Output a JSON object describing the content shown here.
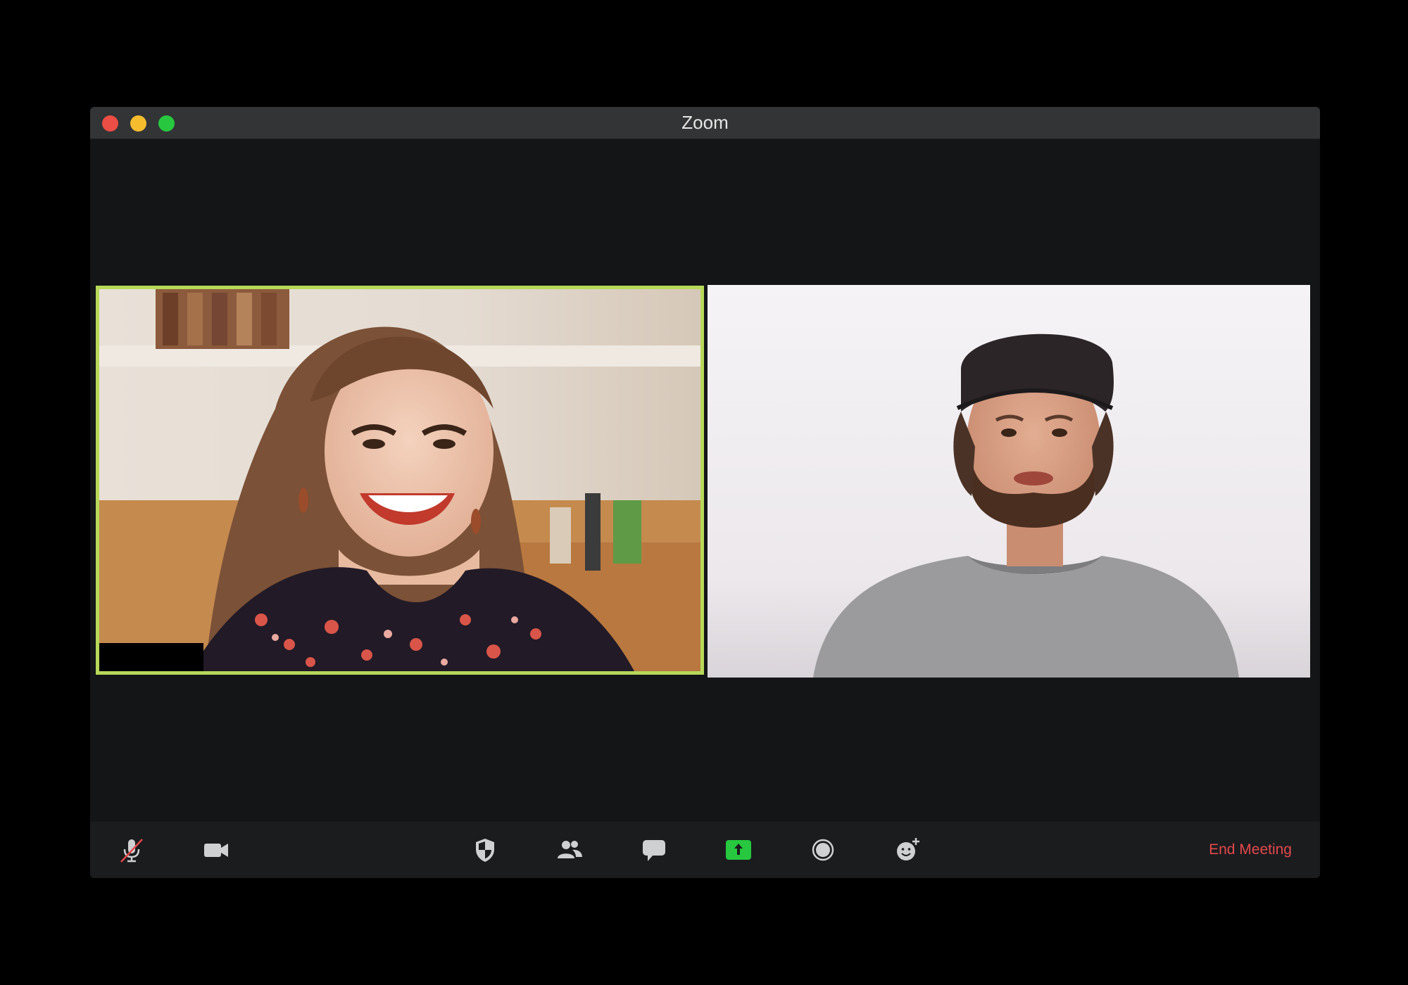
{
  "window": {
    "title": "Zoom",
    "controls": {
      "close_color": "#ec4d44",
      "minimize_color": "#f5bd2e",
      "maximize_color": "#27c83f"
    }
  },
  "participants": [
    {
      "tile": "participant-1",
      "active_speaker": true,
      "highlight_color": "#b7d859",
      "name_label": ""
    },
    {
      "tile": "participant-2",
      "active_speaker": false
    }
  ],
  "toolbar": {
    "left": [
      {
        "name": "mute-button",
        "icon": "microphone-muted-icon"
      },
      {
        "name": "video-button",
        "icon": "video-camera-icon"
      }
    ],
    "center": [
      {
        "name": "security-button",
        "icon": "shield-icon"
      },
      {
        "name": "participants-button",
        "icon": "people-icon"
      },
      {
        "name": "chat-button",
        "icon": "chat-bubble-icon"
      },
      {
        "name": "share-screen-button",
        "icon": "share-screen-icon"
      },
      {
        "name": "record-button",
        "icon": "record-icon"
      },
      {
        "name": "reactions-button",
        "icon": "emoji-add-icon"
      }
    ],
    "share_color": "#27c83f",
    "end_meeting_label": "End Meeting",
    "end_meeting_color": "#e5484d"
  }
}
